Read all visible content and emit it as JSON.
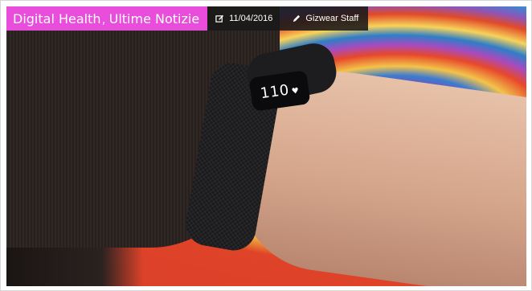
{
  "categories": {
    "items": [
      "Digital Health",
      "Ultime Notizie"
    ],
    "separator": ",",
    "background_color": "#e84ddb"
  },
  "post_meta": {
    "date": "11/04/2016",
    "date_icon": "edit-icon",
    "author": "Gizwear Staff",
    "author_icon": "pencil-icon"
  },
  "image": {
    "device_display_text": "110"
  }
}
